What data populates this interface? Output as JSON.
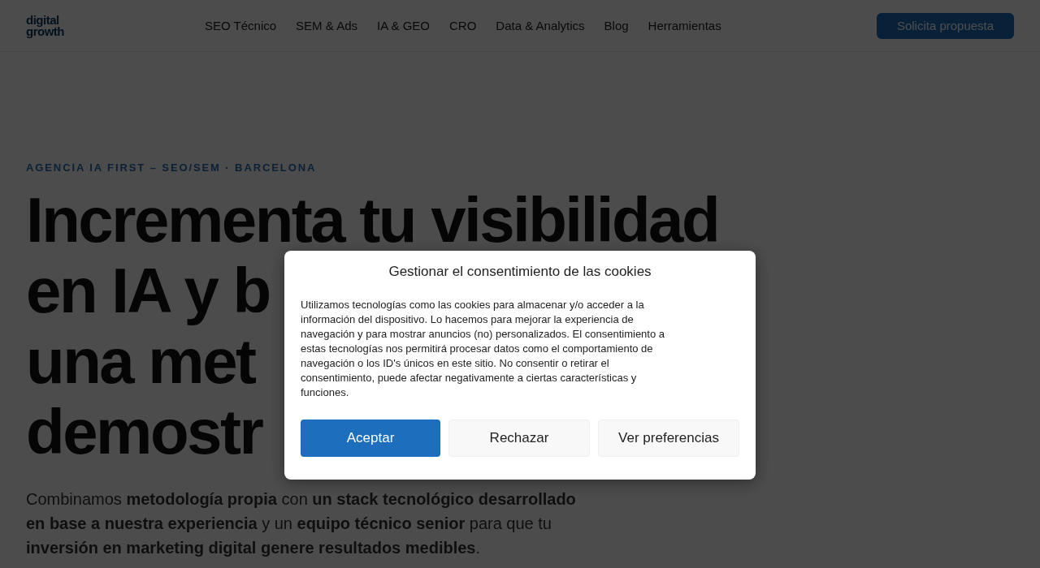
{
  "header": {
    "logo": [
      "digital",
      "growth"
    ],
    "nav": [
      "SEO Técnico",
      "SEM & Ads",
      "IA & GEO",
      "CRO",
      "Data & Analytics",
      "Blog",
      "Herramientas"
    ],
    "cta": "Solicita propuesta"
  },
  "hero": {
    "eyebrow": "AGENCIA IA FIRST – SEO/SEM · BARCELONA",
    "heading_lines": [
      "Incrementa tu visibilidad",
      "en IA y b",
      "una met",
      "demostr"
    ],
    "paragraph": "Combinamos **metodología propia** con **un stack tecnológico desarrollado en base a nuestra experiencia** y un **equipo técnico senior** para que tu **inversión en marketing digital genere resultados medibles**."
  },
  "cookie_dialog": {
    "title": "Gestionar el consentimiento de las cookies",
    "body": "Utilizamos tecnologías como las cookies para almacenar y/o acceder a la información del dispositivo. Lo hacemos para mejorar la experiencia de navegación y para mostrar anuncios (no) personalizados. El consentimiento a estas tecnologías nos permitirá procesar datos como el comportamiento de navegación o los ID's únicos en este sitio. No consentir o retirar el consentimiento, puede afectar negativamente a ciertas características y funciones.",
    "buttons": [
      {
        "label": "Aceptar",
        "kind": "primary"
      },
      {
        "label": "Rechazar",
        "kind": "secondary"
      },
      {
        "label": "Ver preferencias",
        "kind": "secondary"
      }
    ]
  }
}
